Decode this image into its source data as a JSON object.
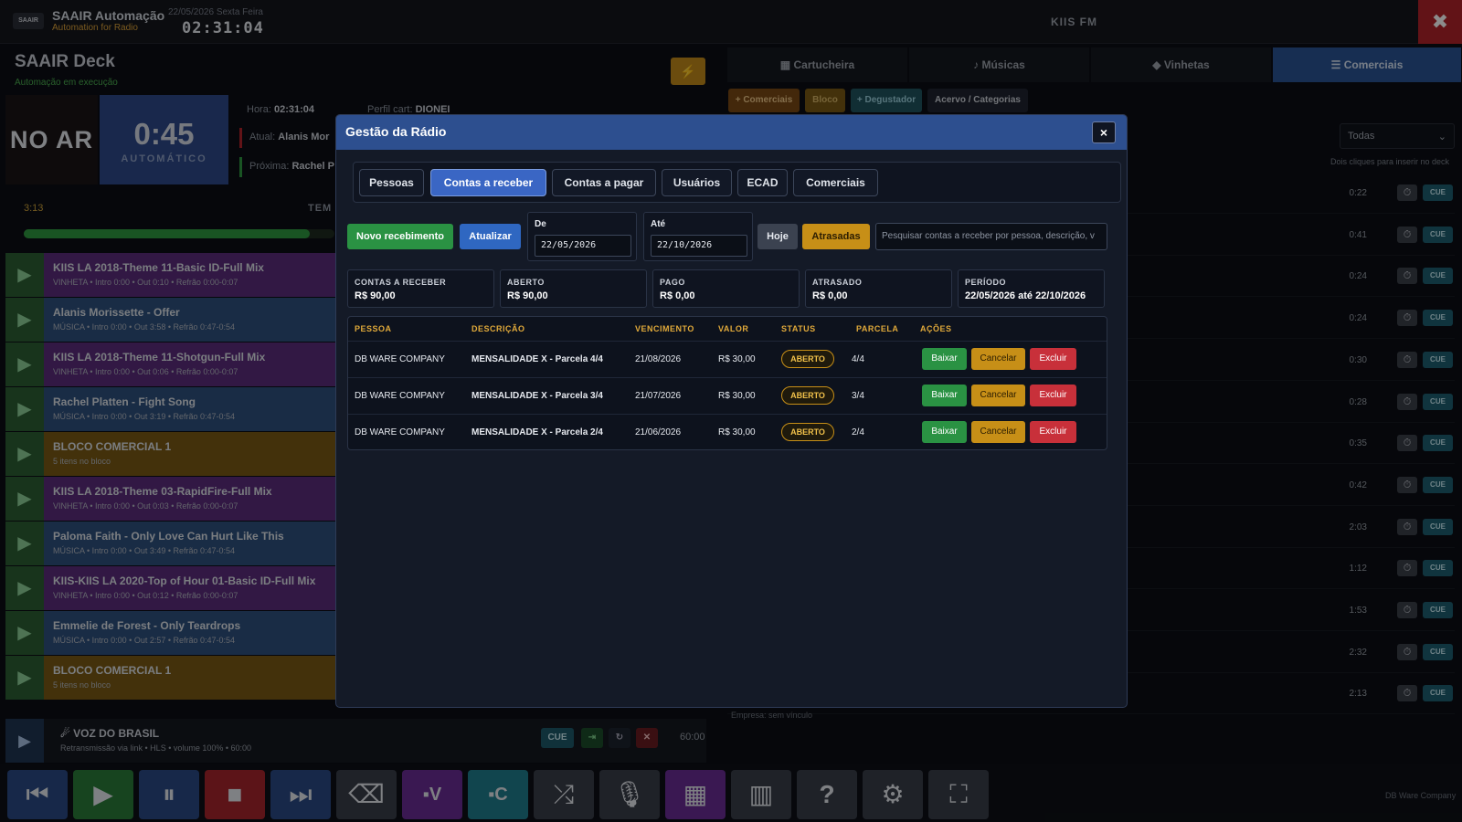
{
  "app": {
    "logo_text": "SAAIR",
    "title": "SAAIR Automação",
    "subtitle": "Automation for Radio",
    "date": "22/05/2026 Sexta Feira",
    "clock": "02:31:04",
    "station": "KIIS FM",
    "close_icon": "close-icon"
  },
  "deck": {
    "title": "SAAIR Deck",
    "status": "Automação em execução",
    "onair": "NO AR",
    "counter": "0:45",
    "mode": "AUTOMÁTICO",
    "hora_label": "Hora:",
    "hora_value": "02:31:04",
    "atual_label": "Atual:",
    "atual_value": "Alanis Mor",
    "proxima_label": "Próxima:",
    "proxima_value": "Rachel P",
    "perfil_label": "Perfil cart:",
    "perfil_value": "DIONEI",
    "elapsed": "3:13",
    "tem_label": "TEM",
    "progress": 0.92,
    "colors": {
      "onair": "#1a1416",
      "counter": "#2f4a8a",
      "progress": "#2e9a40"
    }
  },
  "playlist": [
    {
      "title": "KIIS LA 2018-Theme 11-Basic ID-Full Mix",
      "sub": "VINHETA • Intro 0:00 • Out 0:10 • Refrão 0:00-0:07",
      "kind": "vinheta"
    },
    {
      "title": "Alanis Morissette - Offer",
      "sub": "MÚSICA • Intro 0:00 • Out 3:58 • Refrão 0:47-0:54",
      "kind": "musica"
    },
    {
      "title": "KIIS LA 2018-Theme 11-Shotgun-Full Mix",
      "sub": "VINHETA • Intro 0:00 • Out 0:06 • Refrão 0:00-0:07",
      "kind": "vinheta"
    },
    {
      "title": "Rachel Platten - Fight Song",
      "sub": "MÚSICA • Intro 0:00 • Out 3:19 • Refrão 0:47-0:54",
      "kind": "musica"
    },
    {
      "title": "BLOCO COMERCIAL 1",
      "sub": "5 itens no bloco",
      "kind": "bloco"
    },
    {
      "title": "KIIS LA 2018-Theme 03-RapidFire-Full Mix",
      "sub": "VINHETA • Intro 0:00 • Out 0:03 • Refrão 0:00-0:07",
      "kind": "vinheta"
    },
    {
      "title": "Paloma Faith - Only Love Can Hurt Like This",
      "sub": "MÚSICA • Intro 0:00 • Out 3:49 • Refrão 0:47-0:54",
      "kind": "musica"
    },
    {
      "title": "KIIS-KIIS LA 2020-Top of Hour 01-Basic ID-Full Mix",
      "sub": "VINHETA • Intro 0:00 • Out 0:12 • Refrão 0:00-0:07",
      "kind": "vinheta"
    },
    {
      "title": "Emmelie de Forest - Only Teardrops",
      "sub": "MÚSICA • Intro 0:00 • Out 2:57 • Refrão 0:47-0:54",
      "kind": "musica"
    },
    {
      "title": "BLOCO COMERCIAL 1",
      "sub": "5 itens no bloco",
      "kind": "bloco"
    }
  ],
  "voz": {
    "title": "VOZ DO BRASIL",
    "sub": "Retransmissão via link • HLS • volume 100% • 60:00",
    "cue": "CUE",
    "time": "60:00"
  },
  "right": {
    "tabs": [
      "Cartucheira",
      "Músicas",
      "Vinhetas",
      "Comerciais"
    ],
    "tab_icons": [
      "▦",
      "♪",
      "◆",
      "☰"
    ],
    "sub_buttons": [
      "+ Comerciais",
      "Bloco",
      "+ Degustador",
      "Acervo / Categorias"
    ],
    "filter": "Todas",
    "hint": "Dois cliques para inserir no deck",
    "durations": [
      "0:22",
      "0:41",
      "0:24",
      "0:24",
      "0:30",
      "0:28",
      "0:35",
      "0:42",
      "2:03",
      "1:12",
      "1:53",
      "2:32",
      "2:13"
    ],
    "cue": "CUE",
    "bottom_text": "Empresa: sem vínculo"
  },
  "footer": {
    "company": "DB Ware Company"
  },
  "modal": {
    "title": "Gestão da Rádio",
    "close": "×",
    "tabs": [
      "Pessoas",
      "Contas a receber",
      "Contas a pagar",
      "Usuários",
      "ECAD",
      "Comerciais"
    ],
    "active_tab": 1,
    "btn_novo": "Novo recebimento",
    "btn_atualizar": "Atualizar",
    "de_label": "De",
    "de_value": "22/05/2026",
    "ate_label": "Até",
    "ate_value": "22/10/2026",
    "btn_hoje": "Hoje",
    "btn_atrasadas": "Atrasadas",
    "search_placeholder": "Pesquisar contas a receber por pessoa, descrição, v",
    "summary": [
      {
        "label": "CONTAS A RECEBER",
        "value": "R$ 90,00"
      },
      {
        "label": "ABERTO",
        "value": "R$ 90,00"
      },
      {
        "label": "PAGO",
        "value": "R$ 0,00"
      },
      {
        "label": "ATRASADO",
        "value": "R$ 0,00"
      },
      {
        "label": "PERÍODO",
        "value": "22/05/2026 até 22/10/2026"
      }
    ],
    "columns": [
      "PESSOA",
      "DESCRIÇÃO",
      "VENCIMENTO",
      "VALOR",
      "STATUS",
      "PARCELA",
      "AÇÕES"
    ],
    "rows": [
      {
        "pessoa": "DB WARE COMPANY",
        "descricao": "MENSALIDADE X - Parcela 4/4",
        "vencimento": "21/08/2026",
        "valor": "R$ 30,00",
        "status": "ABERTO",
        "parcela": "4/4"
      },
      {
        "pessoa": "DB WARE COMPANY",
        "descricao": "MENSALIDADE X - Parcela 3/4",
        "vencimento": "21/07/2026",
        "valor": "R$ 30,00",
        "status": "ABERTO",
        "parcela": "3/4"
      },
      {
        "pessoa": "DB WARE COMPANY",
        "descricao": "MENSALIDADE X - Parcela 2/4",
        "vencimento": "21/06/2026",
        "valor": "R$ 30,00",
        "status": "ABERTO",
        "parcela": "2/4"
      }
    ],
    "actions": {
      "baixar": "Baixar",
      "cancelar": "Cancelar",
      "excluir": "Excluir"
    }
  }
}
